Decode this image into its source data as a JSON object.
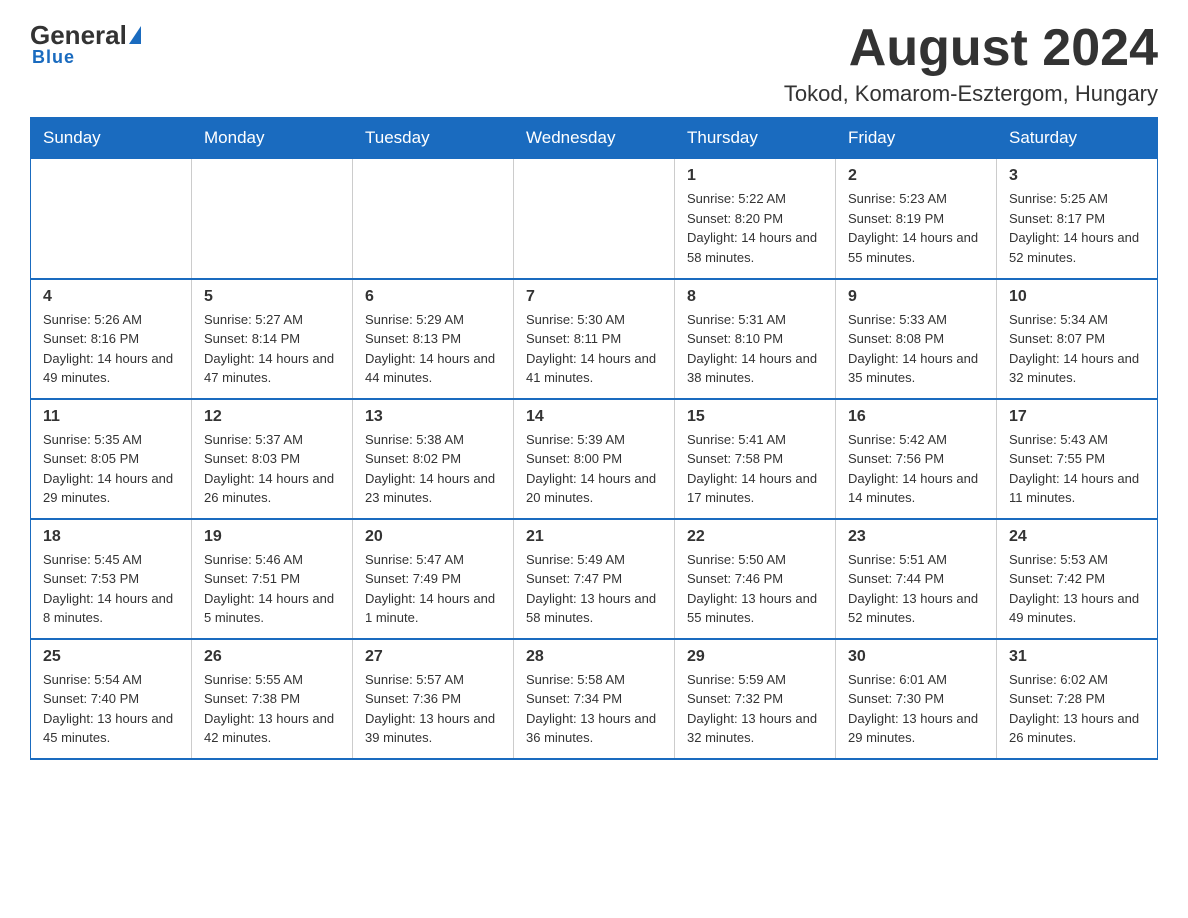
{
  "logo": {
    "general": "General",
    "triangle": "▲",
    "blue": "Blue"
  },
  "title": "August 2024",
  "subtitle": "Tokod, Komarom-Esztergom, Hungary",
  "days_of_week": [
    "Sunday",
    "Monday",
    "Tuesday",
    "Wednesday",
    "Thursday",
    "Friday",
    "Saturday"
  ],
  "weeks": [
    {
      "days": [
        {
          "number": "",
          "info": ""
        },
        {
          "number": "",
          "info": ""
        },
        {
          "number": "",
          "info": ""
        },
        {
          "number": "",
          "info": ""
        },
        {
          "number": "1",
          "info": "Sunrise: 5:22 AM\nSunset: 8:20 PM\nDaylight: 14 hours and 58 minutes."
        },
        {
          "number": "2",
          "info": "Sunrise: 5:23 AM\nSunset: 8:19 PM\nDaylight: 14 hours and 55 minutes."
        },
        {
          "number": "3",
          "info": "Sunrise: 5:25 AM\nSunset: 8:17 PM\nDaylight: 14 hours and 52 minutes."
        }
      ]
    },
    {
      "days": [
        {
          "number": "4",
          "info": "Sunrise: 5:26 AM\nSunset: 8:16 PM\nDaylight: 14 hours and 49 minutes."
        },
        {
          "number": "5",
          "info": "Sunrise: 5:27 AM\nSunset: 8:14 PM\nDaylight: 14 hours and 47 minutes."
        },
        {
          "number": "6",
          "info": "Sunrise: 5:29 AM\nSunset: 8:13 PM\nDaylight: 14 hours and 44 minutes."
        },
        {
          "number": "7",
          "info": "Sunrise: 5:30 AM\nSunset: 8:11 PM\nDaylight: 14 hours and 41 minutes."
        },
        {
          "number": "8",
          "info": "Sunrise: 5:31 AM\nSunset: 8:10 PM\nDaylight: 14 hours and 38 minutes."
        },
        {
          "number": "9",
          "info": "Sunrise: 5:33 AM\nSunset: 8:08 PM\nDaylight: 14 hours and 35 minutes."
        },
        {
          "number": "10",
          "info": "Sunrise: 5:34 AM\nSunset: 8:07 PM\nDaylight: 14 hours and 32 minutes."
        }
      ]
    },
    {
      "days": [
        {
          "number": "11",
          "info": "Sunrise: 5:35 AM\nSunset: 8:05 PM\nDaylight: 14 hours and 29 minutes."
        },
        {
          "number": "12",
          "info": "Sunrise: 5:37 AM\nSunset: 8:03 PM\nDaylight: 14 hours and 26 minutes."
        },
        {
          "number": "13",
          "info": "Sunrise: 5:38 AM\nSunset: 8:02 PM\nDaylight: 14 hours and 23 minutes."
        },
        {
          "number": "14",
          "info": "Sunrise: 5:39 AM\nSunset: 8:00 PM\nDaylight: 14 hours and 20 minutes."
        },
        {
          "number": "15",
          "info": "Sunrise: 5:41 AM\nSunset: 7:58 PM\nDaylight: 14 hours and 17 minutes."
        },
        {
          "number": "16",
          "info": "Sunrise: 5:42 AM\nSunset: 7:56 PM\nDaylight: 14 hours and 14 minutes."
        },
        {
          "number": "17",
          "info": "Sunrise: 5:43 AM\nSunset: 7:55 PM\nDaylight: 14 hours and 11 minutes."
        }
      ]
    },
    {
      "days": [
        {
          "number": "18",
          "info": "Sunrise: 5:45 AM\nSunset: 7:53 PM\nDaylight: 14 hours and 8 minutes."
        },
        {
          "number": "19",
          "info": "Sunrise: 5:46 AM\nSunset: 7:51 PM\nDaylight: 14 hours and 5 minutes."
        },
        {
          "number": "20",
          "info": "Sunrise: 5:47 AM\nSunset: 7:49 PM\nDaylight: 14 hours and 1 minute."
        },
        {
          "number": "21",
          "info": "Sunrise: 5:49 AM\nSunset: 7:47 PM\nDaylight: 13 hours and 58 minutes."
        },
        {
          "number": "22",
          "info": "Sunrise: 5:50 AM\nSunset: 7:46 PM\nDaylight: 13 hours and 55 minutes."
        },
        {
          "number": "23",
          "info": "Sunrise: 5:51 AM\nSunset: 7:44 PM\nDaylight: 13 hours and 52 minutes."
        },
        {
          "number": "24",
          "info": "Sunrise: 5:53 AM\nSunset: 7:42 PM\nDaylight: 13 hours and 49 minutes."
        }
      ]
    },
    {
      "days": [
        {
          "number": "25",
          "info": "Sunrise: 5:54 AM\nSunset: 7:40 PM\nDaylight: 13 hours and 45 minutes."
        },
        {
          "number": "26",
          "info": "Sunrise: 5:55 AM\nSunset: 7:38 PM\nDaylight: 13 hours and 42 minutes."
        },
        {
          "number": "27",
          "info": "Sunrise: 5:57 AM\nSunset: 7:36 PM\nDaylight: 13 hours and 39 minutes."
        },
        {
          "number": "28",
          "info": "Sunrise: 5:58 AM\nSunset: 7:34 PM\nDaylight: 13 hours and 36 minutes."
        },
        {
          "number": "29",
          "info": "Sunrise: 5:59 AM\nSunset: 7:32 PM\nDaylight: 13 hours and 32 minutes."
        },
        {
          "number": "30",
          "info": "Sunrise: 6:01 AM\nSunset: 7:30 PM\nDaylight: 13 hours and 29 minutes."
        },
        {
          "number": "31",
          "info": "Sunrise: 6:02 AM\nSunset: 7:28 PM\nDaylight: 13 hours and 26 minutes."
        }
      ]
    }
  ]
}
